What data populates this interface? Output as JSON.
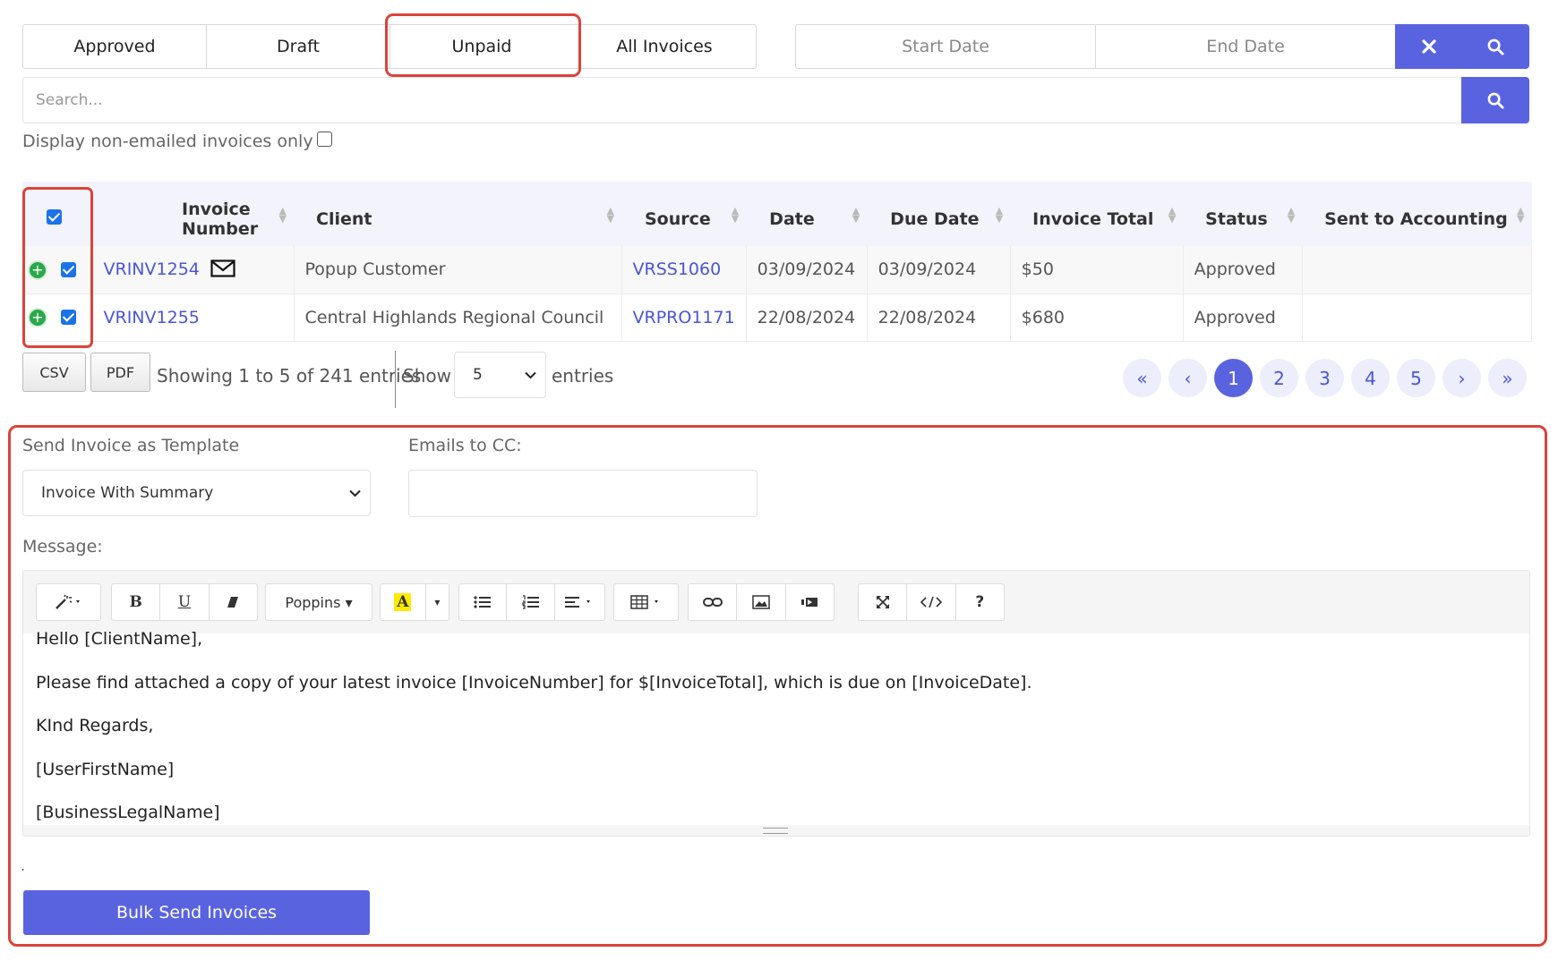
{
  "filter_tabs": [
    "Approved",
    "Draft",
    "Unpaid",
    "All Invoices"
  ],
  "date_range": {
    "start_placeholder": "Start Date",
    "end_placeholder": "End Date"
  },
  "search": {
    "placeholder": "Search..."
  },
  "non_emailed_label": "Display non-emailed invoices only",
  "table": {
    "columns": [
      "Invoice Number",
      "Client",
      "Source",
      "Date",
      "Due Date",
      "Invoice Total",
      "Status",
      "Sent to Accounting"
    ],
    "rows": [
      {
        "invoice": "VRINV1254",
        "client": "Popup Customer",
        "source": "VRSS1060",
        "date": "03/09/2024",
        "due": "03/09/2024",
        "total": "$50",
        "status": "Approved",
        "sent": ""
      },
      {
        "invoice": "VRINV1255",
        "client": "Central Highlands Regional Council",
        "source": "VRPRO1171",
        "date": "22/08/2024",
        "due": "22/08/2024",
        "total": "$680",
        "status": "Approved",
        "sent": ""
      }
    ]
  },
  "controls": {
    "csv": "CSV",
    "pdf": "PDF",
    "showing": "Showing 1 to 5 of 241 entries",
    "show": "Show",
    "page_size": "5",
    "entries": "entries"
  },
  "pagination": {
    "first": "«",
    "prev": "‹",
    "pages": [
      "1",
      "2",
      "3",
      "4",
      "5"
    ],
    "next": "›",
    "last": "»"
  },
  "form": {
    "template_label": "Send Invoice as Template",
    "template_value": "Invoice With Summary",
    "cc_label": "Emails to CC:",
    "message_label": "Message:",
    "font_name": "Poppins",
    "message_lines": [
      "Hello [ClientName],",
      "Please find attached a copy of your latest invoice [InvoiceNumber] for $[InvoiceTotal], which is due on [InvoiceDate].",
      "KInd Regards,",
      "[UserFirstName]",
      "[BusinessLegalName]"
    ],
    "dot": ".",
    "bulk_send": "Bulk Send Invoices"
  },
  "colors": {
    "accent": "#5a63df",
    "highlight": "#d9443a",
    "link": "#4a55d4",
    "add": "#2ba84a"
  }
}
